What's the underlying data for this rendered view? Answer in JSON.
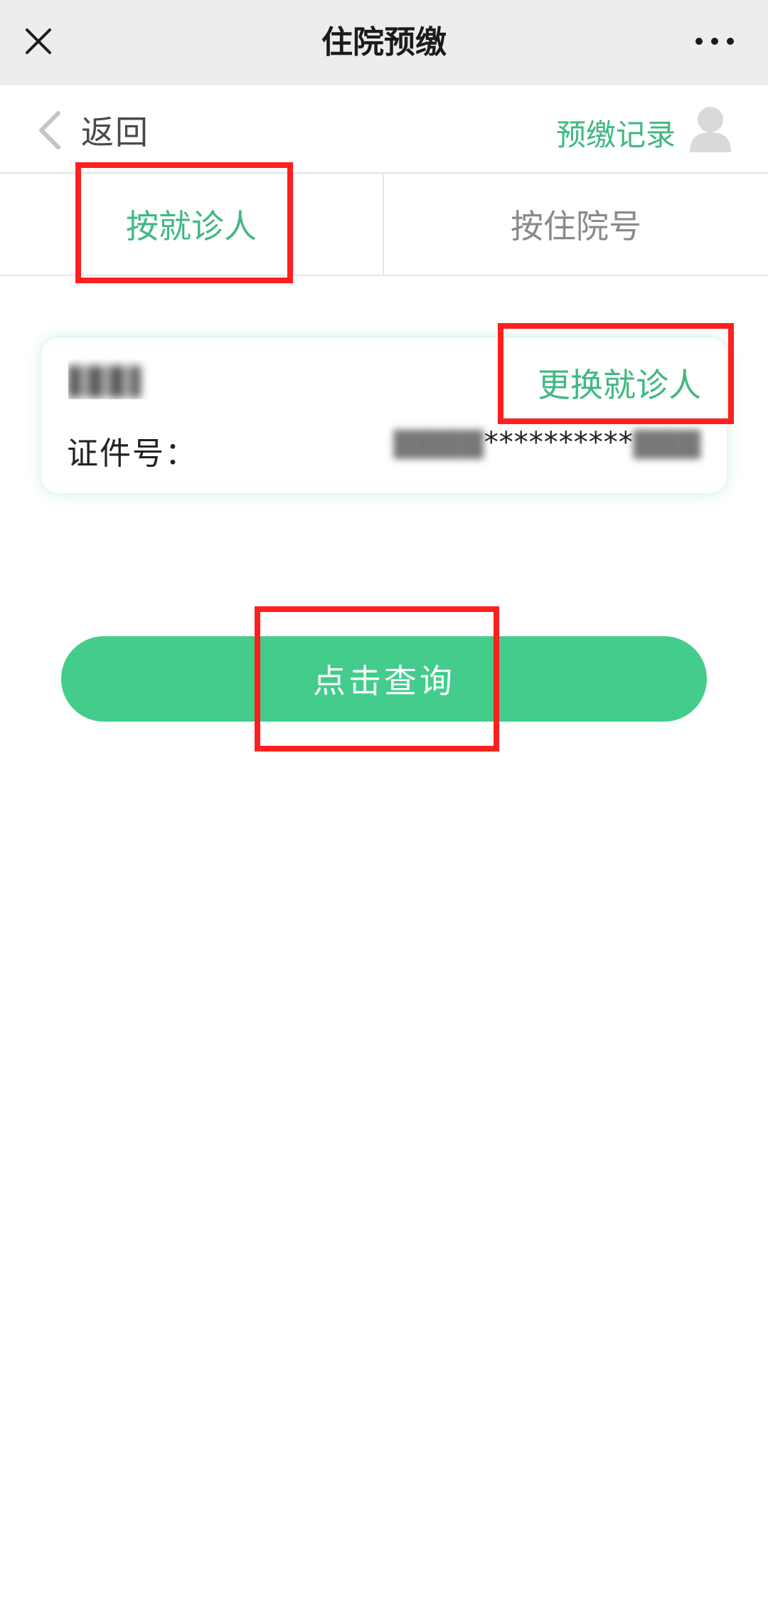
{
  "titlebar": {
    "title": "住院预缴",
    "close_icon": "close-icon",
    "more_icon": "more-icon"
  },
  "navbar": {
    "back_label": "返回",
    "records_label": "预缴记录",
    "avatar_icon": "avatar-icon"
  },
  "tabs": [
    {
      "label": "按就诊人",
      "active": true
    },
    {
      "label": "按住院号",
      "active": false
    }
  ],
  "card": {
    "patient_name": "▇▇▇",
    "change_label": "更换就诊人",
    "id_label": "证件号：",
    "id_prefix": "▇▇▇▇",
    "id_masked": "**********",
    "id_suffix": "▇▇▇"
  },
  "query_button": {
    "label": "点击查询"
  },
  "colors": {
    "accent": "#3fb981",
    "button": "#43cc8c",
    "highlight": "#ff1f1f",
    "titlebar_bg": "#ededed"
  }
}
